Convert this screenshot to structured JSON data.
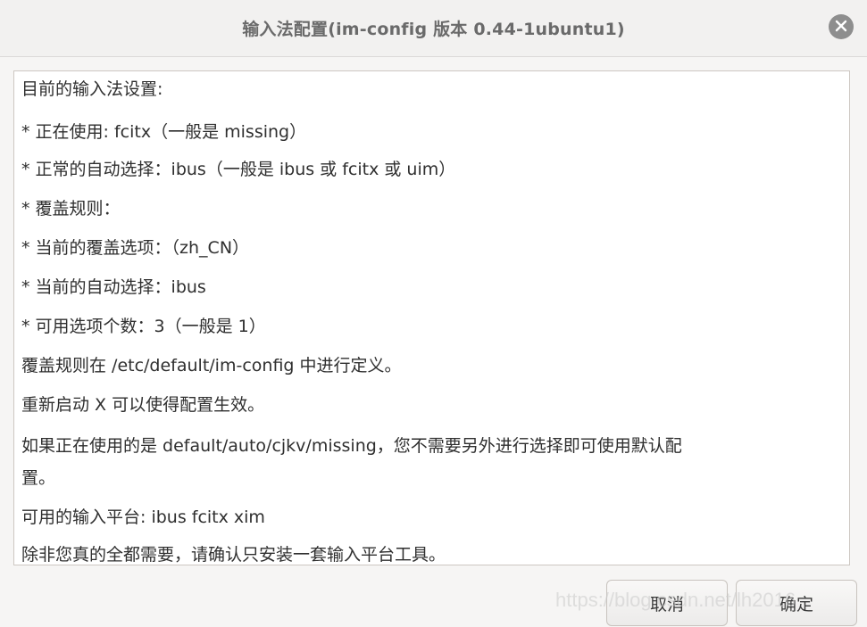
{
  "window": {
    "title": "输入法配置(im-config 版本 0.44-1ubuntu1)",
    "close_icon": "close-icon"
  },
  "message": {
    "lines": [
      "目前的输入法设置:",
      "* 正在使用: fcitx（一般是 missing）",
      "* 正常的自动选择：ibus（一般是 ibus 或 fcitx 或 uim）",
      "* 覆盖规则：",
      "* 当前的覆盖选项：（zh_CN）",
      "* 当前的自动选择：ibus",
      "* 可用选项个数：3（一般是 1）",
      "覆盖规则在 /etc/default/im-config 中进行定义。",
      "重新启动 X 可以使得配置生效。",
      "如果正在使用的是 default/auto/cjkv/missing，您不需要另外进行选择即可使用默认配",
      "置。",
      " 可用的输入平台: ibus fcitx xim",
      "除非您真的全都需要，请确认只安装一套输入平台工具。"
    ]
  },
  "buttons": {
    "cancel_label": "取消",
    "ok_label": "确定"
  },
  "watermark": "https://blog.csdn.net/lh2016"
}
